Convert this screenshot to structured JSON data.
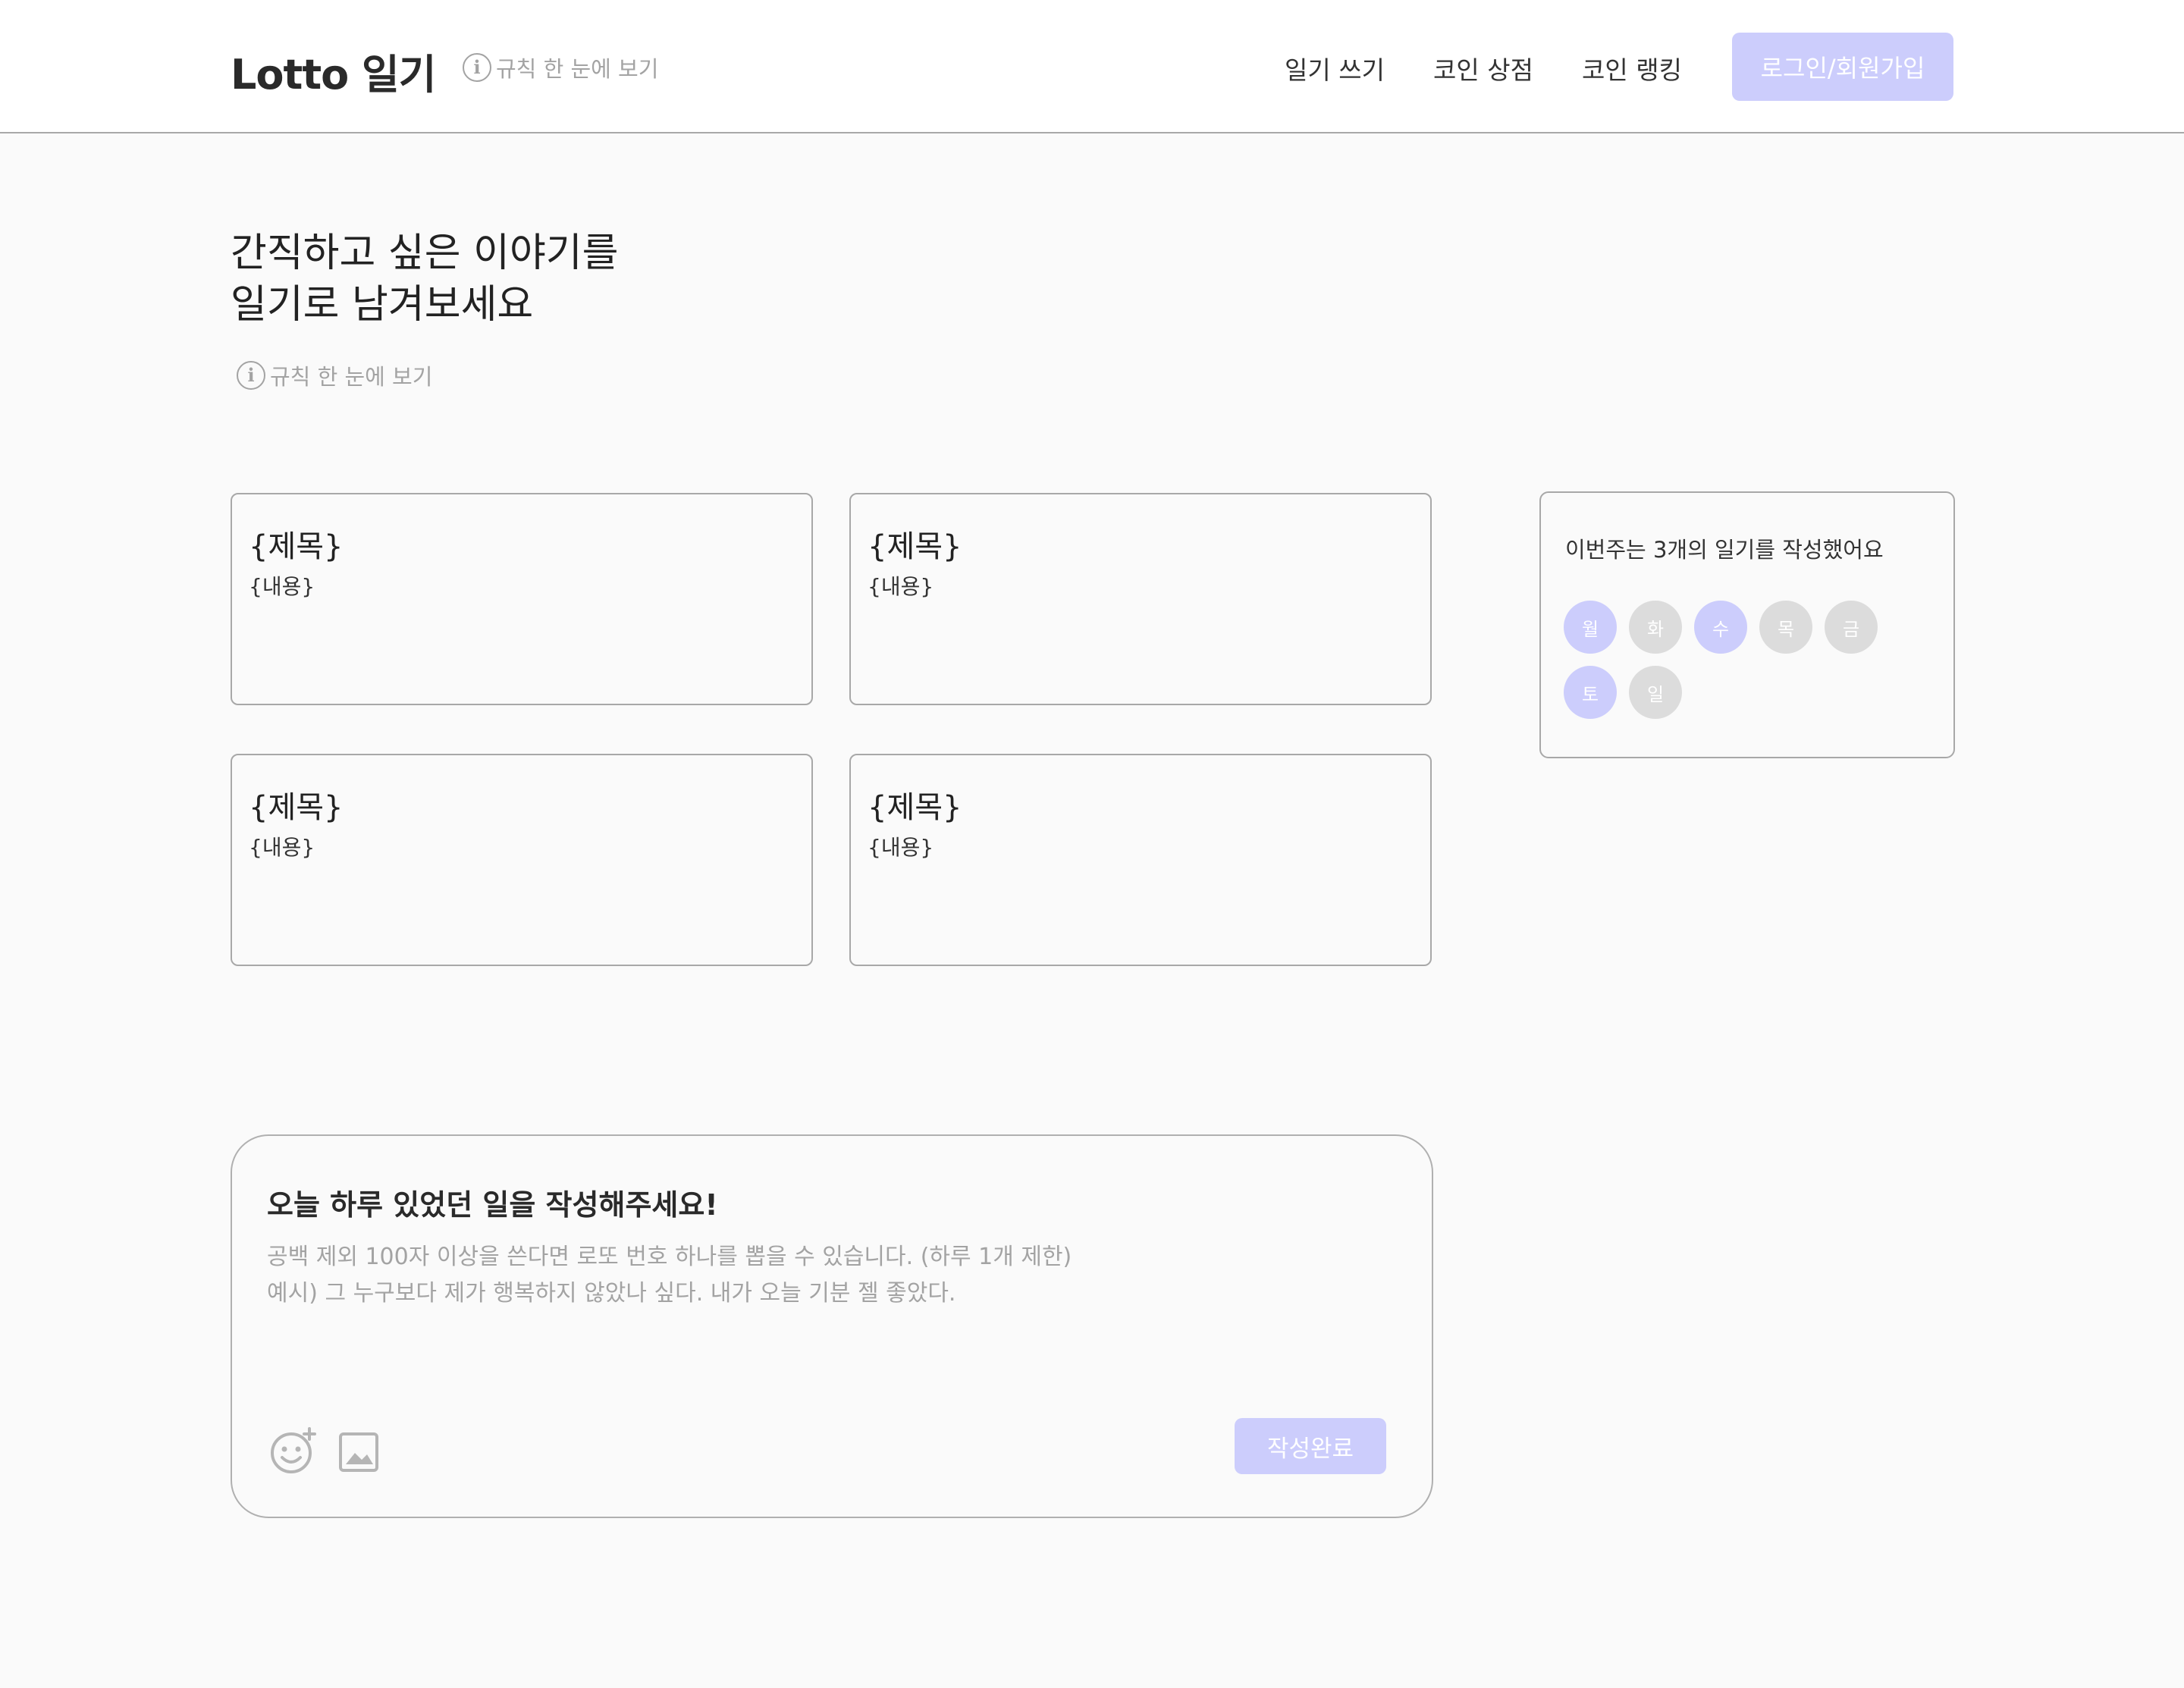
{
  "header": {
    "logo": "Lotto 일기",
    "rules_link": "규칙 한 눈에 보기",
    "nav": [
      "일기 쓰기",
      "코인 상점",
      "코인 랭킹"
    ],
    "login_button": "로그인/회원가입"
  },
  "hero": {
    "title_line1": "간직하고 싶은 이야기를",
    "title_line2": "일기로 남겨보세요",
    "rules_link": "규칙 한 눈에 보기"
  },
  "cards": [
    {
      "title": "{제목}",
      "content": "{내용}"
    },
    {
      "title": "{제목}",
      "content": "{내용}"
    },
    {
      "title": "{제목}",
      "content": "{내용}"
    },
    {
      "title": "{제목}",
      "content": "{내용}"
    }
  ],
  "weekly": {
    "text": "이번주는 3개의 일기를 작성했어요",
    "days": [
      {
        "label": "월",
        "written": true
      },
      {
        "label": "화",
        "written": false
      },
      {
        "label": "수",
        "written": true
      },
      {
        "label": "목",
        "written": false
      },
      {
        "label": "금",
        "written": false
      },
      {
        "label": "토",
        "written": true
      },
      {
        "label": "일",
        "written": false
      }
    ],
    "written_color": "#cccdfc",
    "empty_color": "#dcdcdc"
  },
  "compose": {
    "heading": "오늘 하루 있었던 일을 작성해주세요!",
    "placeholder": "공백 제외 100자 이상을 쓴다면 로또 번호 하나를 뽑을 수 있습니다. (하루 1개 제한)\n예시) 그 누구보다 제가 행복하지 않았나 싶다. 내가 오늘 기분 젤 좋았다.",
    "submit_label": "작성완료",
    "icons": [
      "emoji-add-icon",
      "image-icon"
    ]
  },
  "colors": {
    "accent": "#cccdfc",
    "muted_text": "#a3a3a3"
  }
}
